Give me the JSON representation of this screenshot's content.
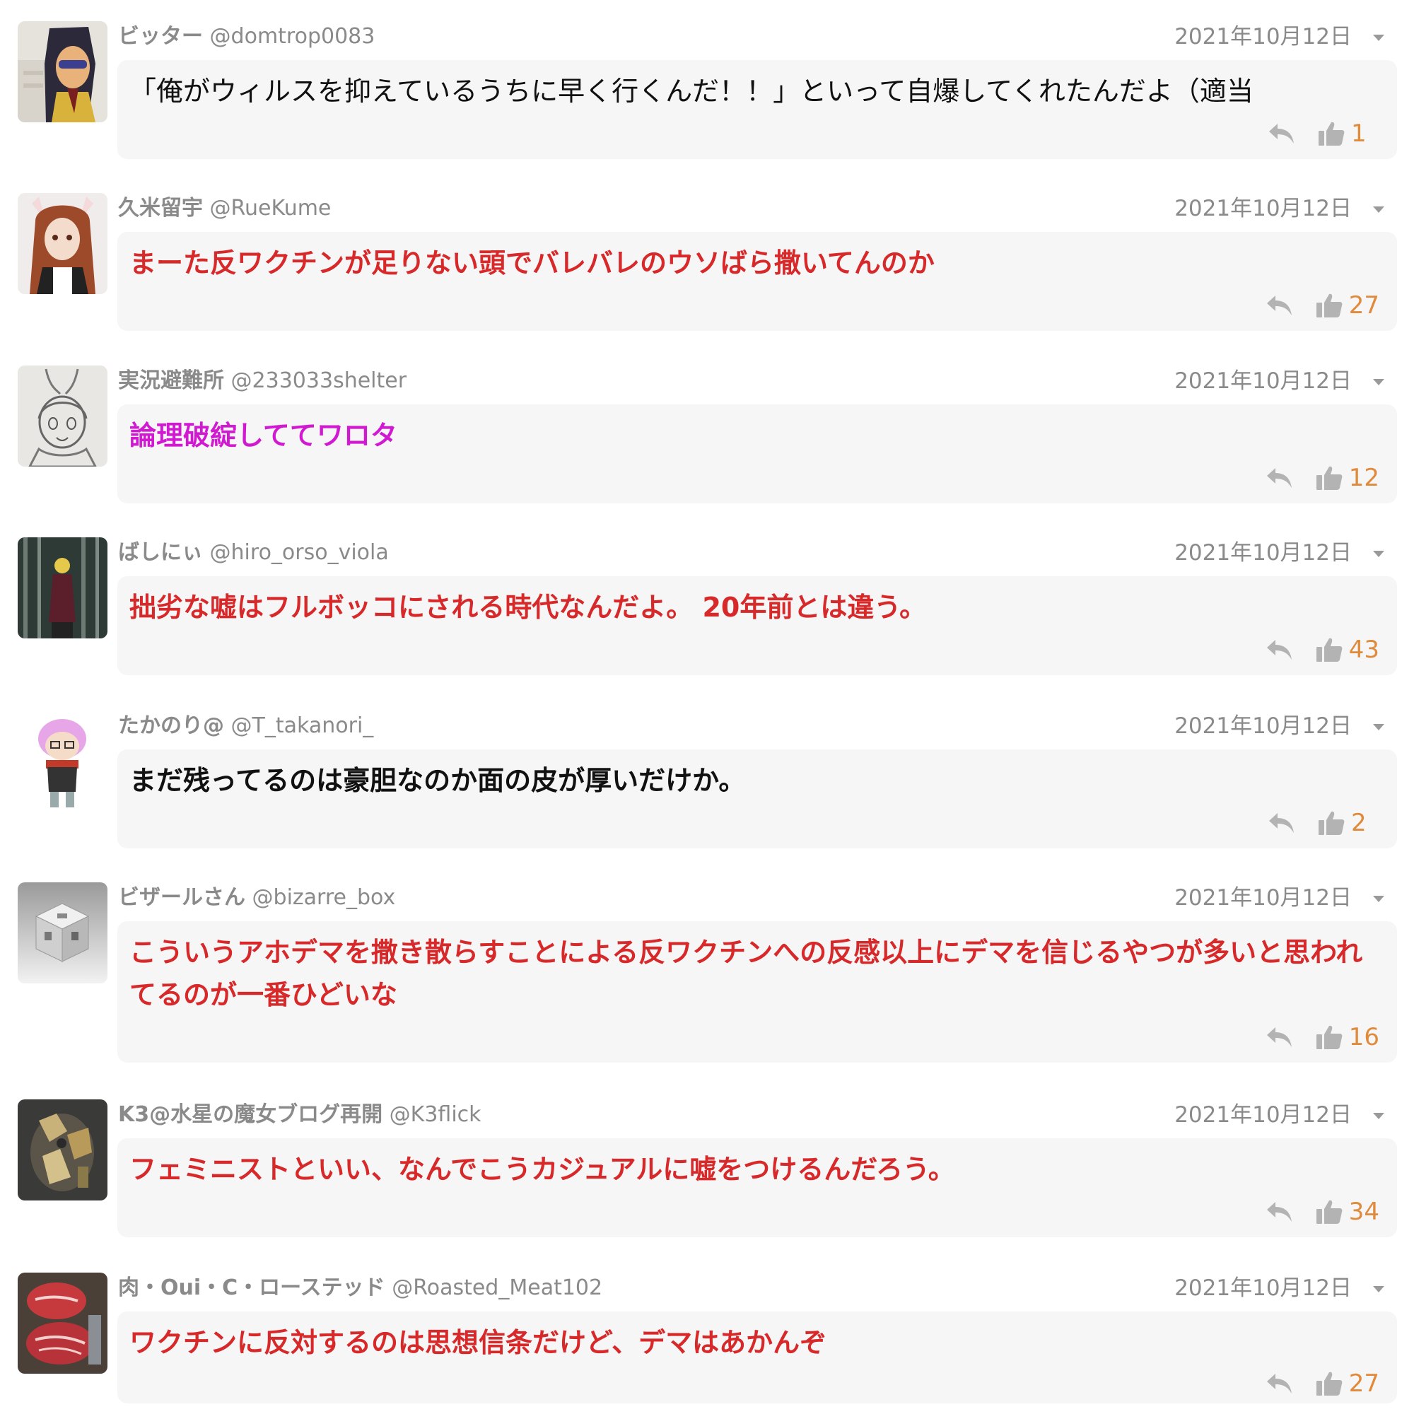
{
  "comments": [
    {
      "display_name": "ビッター",
      "handle": "@domtrop0083",
      "date": "2021年10月12日",
      "text": "「俺がウィルスを抑えているうちに早く行くんだ！！」といって自爆してくれたんだよ（適当",
      "likes": "1",
      "avatar": "avatar-sunglasses-character"
    },
    {
      "display_name": "久米留宇",
      "handle": "@RueKume",
      "date": "2021年10月12日",
      "text": "まーた反ワクチンが足りない頭でバレバレのウソばら撒いてんのか",
      "likes": "27",
      "avatar": "avatar-doll-with-cat-ears"
    },
    {
      "display_name": "実況避難所",
      "handle": "@233033shelter",
      "date": "2021年10月12日",
      "text": "論理破綻しててワロタ",
      "likes": "12",
      "avatar": "avatar-anime-sketch"
    },
    {
      "display_name": "ばしにぃ",
      "handle": "@hiro_orso_viola",
      "date": "2021年10月12日",
      "text": "拙劣な嘘はフルボッコにされる時代なんだよ。 20年前とは違う。",
      "likes": "43",
      "avatar": "avatar-figure-in-forest"
    },
    {
      "display_name": "たかのり@",
      "handle": "@T_takanori_",
      "date": "2021年10月12日",
      "text": "まだ残ってるのは豪胆なのか面の皮が厚いだけか。",
      "likes": "2",
      "avatar": "avatar-pink-hair-chibi"
    },
    {
      "display_name": "ビザールさん",
      "handle": "@bizarre_box",
      "date": "2021年10月12日",
      "text": "こういうアホデマを撒き散らすことによる反ワクチンへの反感以上にデマを信じるやつが多いと思われてるのが一番ひどいな",
      "likes": "16",
      "avatar": "avatar-menger-cube"
    },
    {
      "display_name": "K3@水星の魔女ブログ再開",
      "handle": "@K3flick",
      "date": "2021年10月12日",
      "text": "フェミニストといい、なんでこうカジュアルに嘘をつけるんだろう。",
      "likes": "34",
      "avatar": "avatar-mech-figure"
    },
    {
      "display_name": "肉・Oui・C・ローステッド",
      "handle": "@Roasted_Meat102",
      "date": "2021年10月12日",
      "text": "ワクチンに反対するのは思想信条だけど、デマはあかんぞ",
      "likes": "27",
      "avatar": "avatar-raw-meat"
    }
  ],
  "colors": {
    "red_text": "#d7282a",
    "magenta_text": "#d119d1",
    "meta_gray": "#8a8a8a",
    "like_orange": "#e08a3c",
    "bubble_bg": "#f6f6f6",
    "icon_gray": "#b3b3b3"
  },
  "icons": [
    "reply-icon",
    "like-icon",
    "chevron-down-icon"
  ]
}
